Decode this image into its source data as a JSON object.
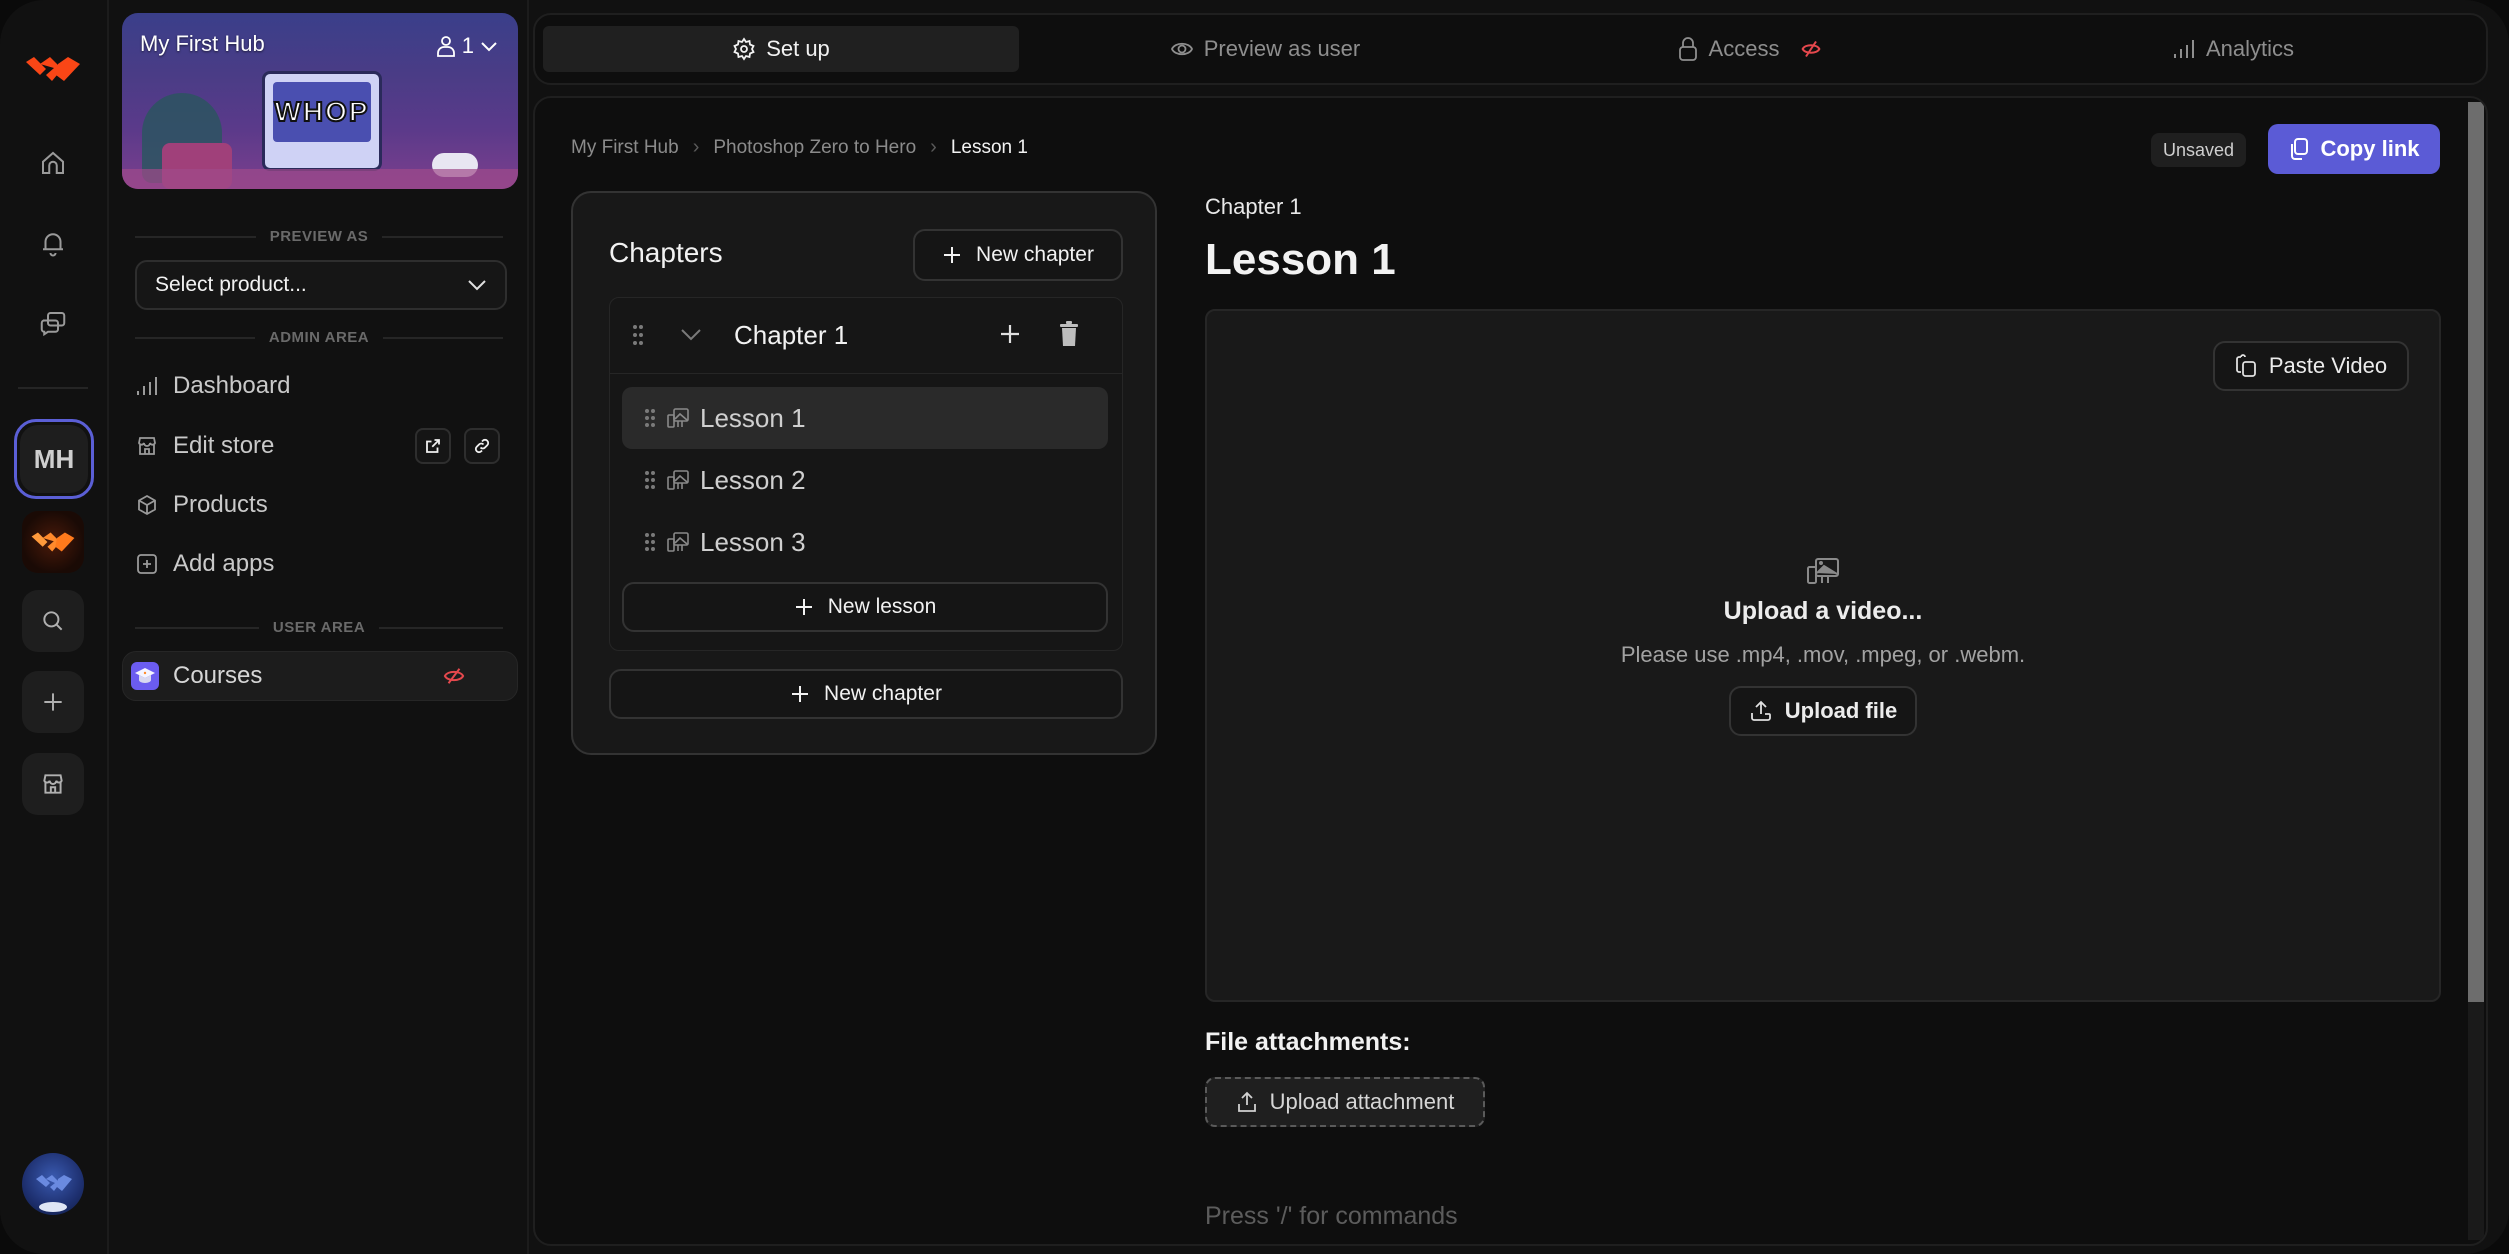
{
  "rail": {
    "workspace_initials": "MH",
    "items": [
      {
        "name": "home",
        "icon": "home-icon"
      },
      {
        "name": "notifications",
        "icon": "bell-icon"
      },
      {
        "name": "messages",
        "icon": "chat-icon"
      },
      {
        "name": "search",
        "icon": "search-icon"
      },
      {
        "name": "add",
        "icon": "plus-icon"
      },
      {
        "name": "store",
        "icon": "store-icon"
      }
    ]
  },
  "hub": {
    "title": "My First Hub",
    "member_count": "1",
    "banner_text": "WHOP"
  },
  "sidebar": {
    "preview_as_label": "PREVIEW AS",
    "select_placeholder": "Select product...",
    "admin_area_label": "ADMIN AREA",
    "admin_items": [
      {
        "label": "Dashboard",
        "icon": "bar-chart-icon"
      },
      {
        "label": "Edit store",
        "icon": "store-icon"
      },
      {
        "label": "Products",
        "icon": "box-icon"
      },
      {
        "label": "Add apps",
        "icon": "plus-square-icon"
      }
    ],
    "user_area_label": "USER AREA",
    "user_items": [
      {
        "label": "Courses",
        "icon": "graduation-cap-icon",
        "status": "hidden",
        "status_color": "#e5484d"
      }
    ]
  },
  "topnav": {
    "tabs": [
      {
        "label": "Set up",
        "icon": "gear-icon",
        "active": true
      },
      {
        "label": "Preview as user",
        "icon": "eye-icon",
        "active": false
      },
      {
        "label": "Access",
        "icon": "lock-icon",
        "active": false,
        "badge": "eye-off-icon"
      },
      {
        "label": "Analytics",
        "icon": "bar-chart-icon",
        "active": false
      }
    ]
  },
  "breadcrumb": [
    "My First Hub",
    "Photoshop Zero to Hero",
    "Lesson 1"
  ],
  "header": {
    "status": "Unsaved",
    "copy_link_label": "Copy link",
    "accent": "#5b5bd6"
  },
  "chapters": {
    "title": "Chapters",
    "new_chapter_label": "New chapter",
    "items": [
      {
        "title": "Chapter 1",
        "lessons": [
          {
            "label": "Lesson 1",
            "active": true
          },
          {
            "label": "Lesson 2",
            "active": false
          },
          {
            "label": "Lesson 3",
            "active": false
          }
        ],
        "new_lesson_label": "New lesson"
      }
    ],
    "bottom_new_chapter_label": "New chapter"
  },
  "lesson": {
    "chapter": "Chapter 1",
    "title": "Lesson 1",
    "paste_video_label": "Paste Video",
    "upload_title": "Upload a video...",
    "upload_hint": "Please use .mp4, .mov, .mpeg, or .webm.",
    "upload_file_label": "Upload file",
    "attachments_label": "File attachments:",
    "upload_attachment_label": "Upload attachment",
    "editor_placeholder": "Press '/' for commands"
  }
}
